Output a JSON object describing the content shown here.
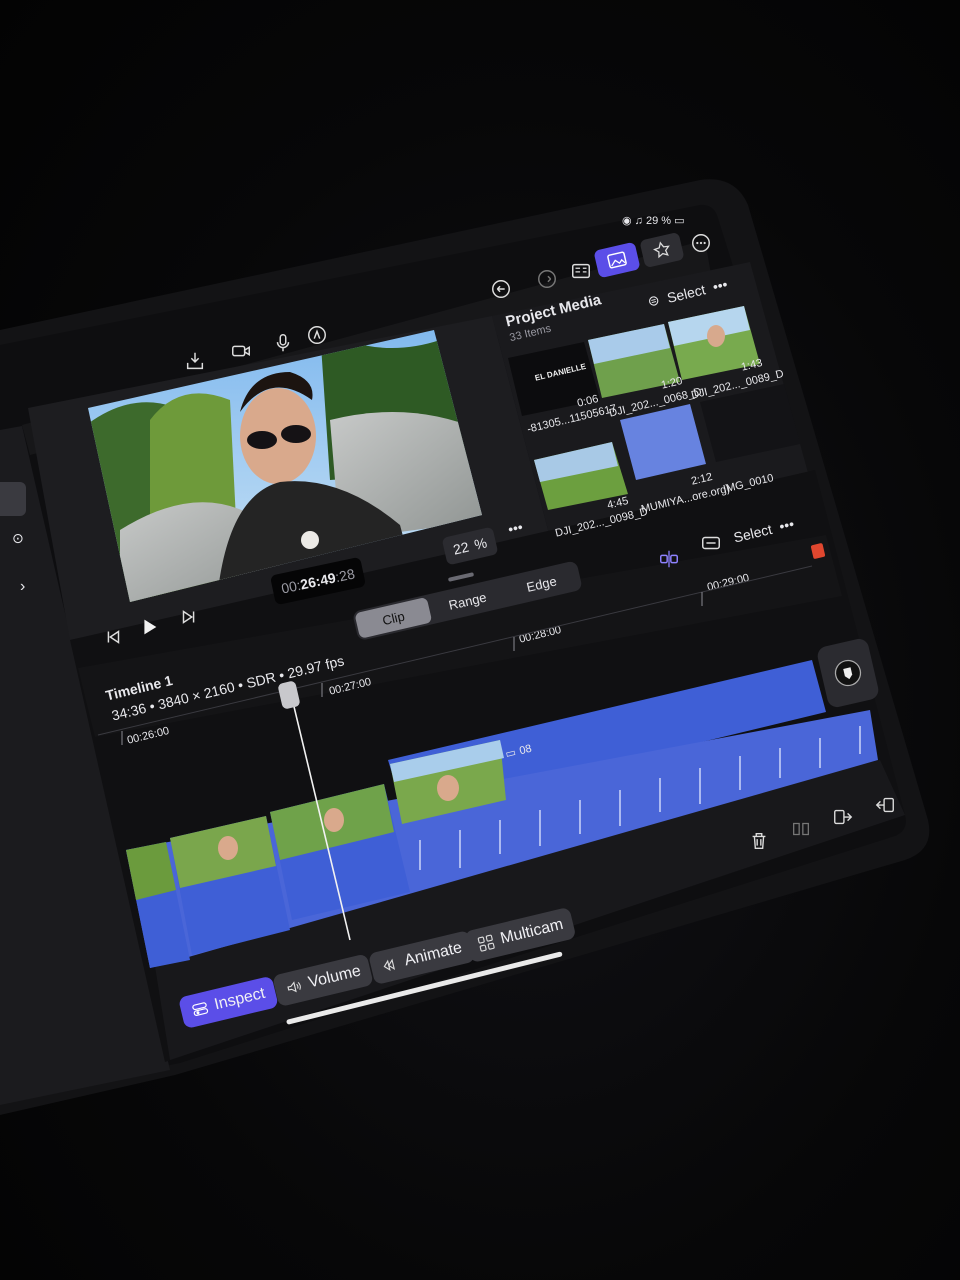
{
  "status": {
    "battery": "29 %"
  },
  "toolbar": {
    "select_label": "Select",
    "more_label": "•••"
  },
  "project_media": {
    "title": "Project Media",
    "count": "33 Items",
    "select_label": "Select",
    "items": [
      {
        "name": "-81305...11505617",
        "duration": "0:06",
        "thumb_text": "EL DANIELLE"
      },
      {
        "name": "DJI_202..._0068_D",
        "duration": "1:20"
      },
      {
        "name": "DJI_202..._0089_D",
        "duration": "1:43"
      },
      {
        "name": "DJI_202..._0098_D",
        "duration": "4:45"
      },
      {
        "name": "MUMIYA...ore.org)",
        "duration": "2:12"
      },
      {
        "name": "IMG_0010",
        "duration": ""
      }
    ]
  },
  "viewer": {
    "zoom_value": "22",
    "zoom_unit": "%",
    "timecode_prefix": "00:",
    "timecode_main": "26:49",
    "timecode_frames": ":28"
  },
  "edit_modes": {
    "clip": "Clip",
    "range": "Range",
    "edge": "Edge",
    "active": "Clip"
  },
  "timeline": {
    "title": "Timeline 1",
    "info": "34:36 • 3840 × 2160 • SDR • 29.97 fps",
    "select_label": "Select",
    "ruler": [
      "00:26:00",
      "00:27:00",
      "00:28:00",
      "00:29:00"
    ],
    "clip_label": "08"
  },
  "bottom_bar": {
    "inspect": "Inspect",
    "volume": "Volume",
    "animate": "Animate",
    "multicam": "Multicam"
  },
  "colors": {
    "accent": "#5b4ee8",
    "clip_blue": "#3f5fd6",
    "audio_blue": "#4a66d8",
    "panel": "#1c1c1f",
    "record": "#e0472f"
  }
}
